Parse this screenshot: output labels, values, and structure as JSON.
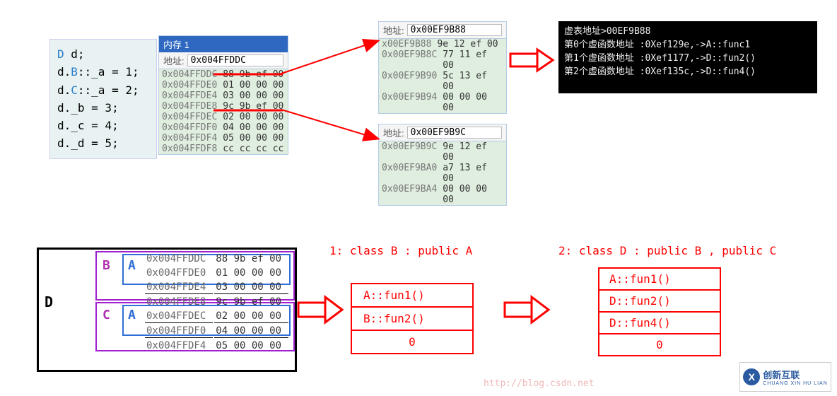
{
  "code": {
    "l1_a": "D",
    "l1_b": " d;",
    "l2_a": "d.",
    "l2_b": "B",
    "l2_c": "::_a = 1;",
    "l3_a": "d.",
    "l3_b": "C",
    "l3_c": "::_a = 2;",
    "l4": "d._b = 3;",
    "l5": "d._c = 4;",
    "l6": "d._d = 5;"
  },
  "panel1": {
    "title": "内存 1",
    "addr_label": "地址:",
    "addr_value": "0x004FFDDC",
    "rows": [
      {
        "a": "0x004FFDDC",
        "b": "88 9b ef 00"
      },
      {
        "a": "0x004FFDE0",
        "b": "01 00 00 00"
      },
      {
        "a": "0x004FFDE4",
        "b": "03 00 00 00"
      },
      {
        "a": "0x004FFDE8",
        "b": "9c 9b ef 00"
      },
      {
        "a": "0x004FFDEC",
        "b": "02 00 00 00"
      },
      {
        "a": "0x004FFDF0",
        "b": "04 00 00 00"
      },
      {
        "a": "0x004FFDF4",
        "b": "05 00 00 00"
      },
      {
        "a": "0x004FFDF8",
        "b": "cc cc cc cc"
      }
    ]
  },
  "panel2": {
    "addr_label": "地址:",
    "addr_value": "0x00EF9B88",
    "rows": [
      {
        "a": "x00EF9B88",
        "b": "9e 12 ef 00"
      },
      {
        "a": "0x00EF9B8C",
        "b": "77 11 ef 00"
      },
      {
        "a": "0x00EF9B90",
        "b": "5c 13 ef 00"
      },
      {
        "a": "0x00EF9B94",
        "b": "00 00 00 00"
      }
    ]
  },
  "panel3": {
    "addr_label": "地址:",
    "addr_value": "0x00EF9B9C",
    "rows": [
      {
        "a": "0x00EF9B9C",
        "b": "9e 12 ef 00"
      },
      {
        "a": "0x00EF9BA0",
        "b": "a7 13 ef 00"
      },
      {
        "a": "0x00EF9BA4",
        "b": "00 00 00 00"
      }
    ]
  },
  "console": {
    "line1": "虚表地址>00EF9B88",
    "line2": "第0个虚函数地址 :0Xef129e,->A::func1",
    "line3": "第1个虚函数地址 :0Xef1177,->D::fun2()",
    "line4": "第2个虚函数地址 :0Xef135c,->D::fun4()"
  },
  "bottom": {
    "D": "D",
    "B": "B",
    "C": "C",
    "A": "A",
    "rows": [
      {
        "a": "0x004FFDDC",
        "b": "88 9b ef 00"
      },
      {
        "a": "0x004FFDE0",
        "b": "01 00 00 00"
      },
      {
        "a": "0x004FFDE4",
        "b": "03 00 00 00"
      },
      {
        "a": "0x004FFDE8",
        "b": "9c 9b ef 00"
      },
      {
        "a": "0x004FFDEC",
        "b": "02 00 00 00"
      },
      {
        "a": "0x004FFDF0",
        "b": "04 00 00 00"
      },
      {
        "a": "0x004FFDF4",
        "b": "05 00 00 00"
      }
    ],
    "title1": "1: class B : public A",
    "box1": [
      "A::fun1()",
      "B::fun2()",
      "0"
    ],
    "title2": "2: class D : public B , public C",
    "box2": [
      "A::fun1()",
      "D::fun2()",
      "D::fun4()",
      "0"
    ]
  },
  "footer_url": "http://blog.csdn.net",
  "logo": {
    "main": "创新互联",
    "sub": "CHUANG XIN HU LIAN"
  }
}
